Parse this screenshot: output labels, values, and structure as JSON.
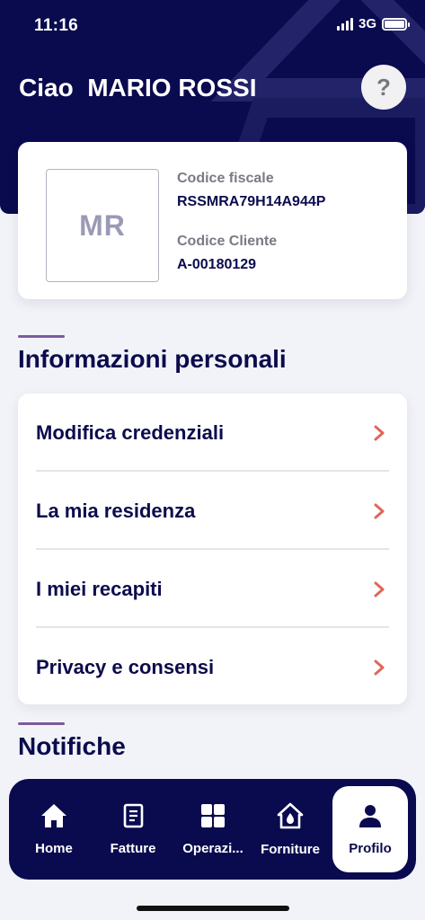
{
  "status_bar": {
    "time": "11:16",
    "network": "3G"
  },
  "header": {
    "greeting": "Ciao  MARIO ROSSI",
    "help_label": "?"
  },
  "profile": {
    "initials": "MR",
    "tax_code_label": "Codice fiscale",
    "tax_code_value": "RSSMRA79H14A944P",
    "customer_code_label": "Codice Cliente",
    "customer_code_value": "A-00180129"
  },
  "sections": {
    "personal_info_title": "Informazioni personali",
    "notifications_title": "Notifiche"
  },
  "menu": {
    "items": [
      {
        "label": "Modifica credenziali"
      },
      {
        "label": "La mia residenza"
      },
      {
        "label": "I miei recapiti"
      },
      {
        "label": "Privacy e consensi"
      }
    ]
  },
  "tabbar": {
    "tabs": [
      {
        "label": "Home",
        "icon": "home-icon"
      },
      {
        "label": "Fatture",
        "icon": "invoice-icon"
      },
      {
        "label": "Operazi...",
        "icon": "grid-icon"
      },
      {
        "label": "Forniture",
        "icon": "supply-house-icon"
      },
      {
        "label": "Profilo",
        "icon": "person-icon",
        "active": true
      }
    ]
  },
  "colors": {
    "brand_navy": "#0a0a4f",
    "accent_chevron": "#e0665a",
    "section_rule": "#7c5a9e"
  }
}
